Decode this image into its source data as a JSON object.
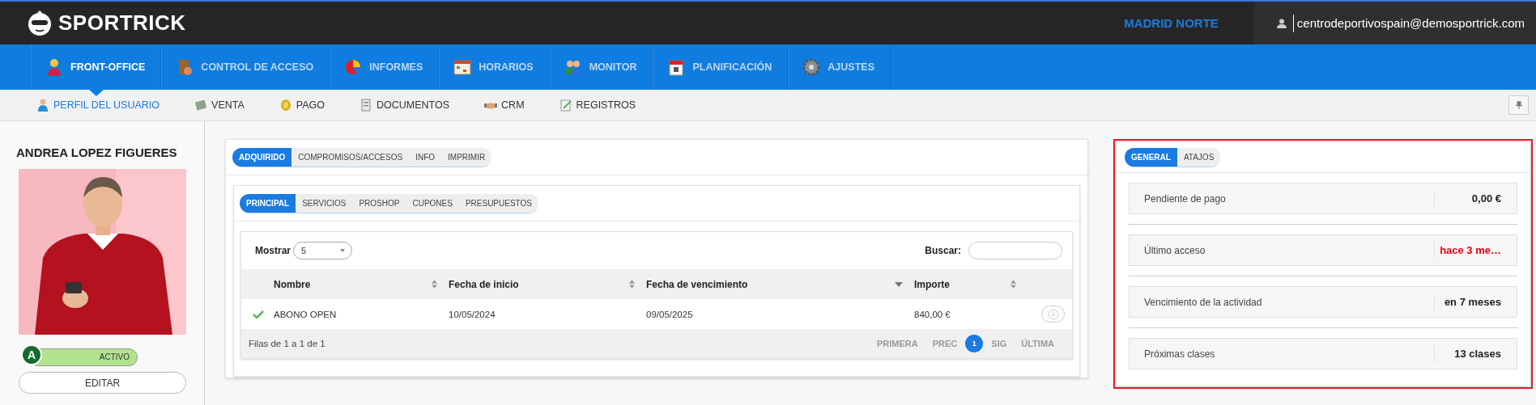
{
  "brand": {
    "name": "SPORTRICK"
  },
  "top_bar": {
    "location": "MADRID NORTE",
    "user_email": "centrodeportivospain@demosportrick.com"
  },
  "main_nav": [
    {
      "label": "FRONT-OFFICE",
      "selected": true
    },
    {
      "label": "CONTROL DE ACCESO",
      "selected": false
    },
    {
      "label": "INFORMES",
      "selected": false
    },
    {
      "label": "HORARIOS",
      "selected": false
    },
    {
      "label": "MONITOR",
      "selected": false
    },
    {
      "label": "PLANIFICACIÓN",
      "selected": false
    },
    {
      "label": "AJUSTES",
      "selected": false
    }
  ],
  "sub_nav": [
    {
      "label": "PERFIL DEL USUARIO",
      "selected": true
    },
    {
      "label": "VENTA",
      "selected": false
    },
    {
      "label": "PAGO",
      "selected": false
    },
    {
      "label": "DOCUMENTOS",
      "selected": false
    },
    {
      "label": "CRM",
      "selected": false
    },
    {
      "label": "REGISTROS",
      "selected": false
    }
  ],
  "profile": {
    "name": "ANDREA LOPEZ FIGUERES",
    "avatar_letter": "A",
    "status": "ACTIVO",
    "active": true,
    "edit_button": "EDITAR"
  },
  "section_tabs": [
    {
      "label": "ADQUIRIDO",
      "selected": true
    },
    {
      "label": "COMPROMISOS/ACCESOS",
      "selected": false
    },
    {
      "label": "INFO",
      "selected": false
    },
    {
      "label": "IMPRIMIR",
      "selected": false
    }
  ],
  "product_tabs": [
    {
      "label": "PRINCIPAL",
      "selected": true
    },
    {
      "label": "SERVICIOS",
      "selected": false
    },
    {
      "label": "PROSHOP",
      "selected": false
    },
    {
      "label": "CUPONES",
      "selected": false
    },
    {
      "label": "PRESUPUESTOS",
      "selected": false
    }
  ],
  "table": {
    "show_label": "Mostrar",
    "page_size": "5",
    "search_label": "Buscar:",
    "columns": [
      {
        "label": "Nombre",
        "sorted": false
      },
      {
        "label": "Fecha de inicio",
        "sorted": false
      },
      {
        "label": "Fecha de vencimiento",
        "sorted": true
      },
      {
        "label": "Importe",
        "sorted": false
      }
    ],
    "rows": [
      {
        "active": true,
        "cells": [
          "ABONO OPEN",
          "10/05/2024",
          "09/05/2025",
          "840,00 €"
        ]
      }
    ],
    "info": "Filas de 1 a 1 de 1",
    "pagination": [
      {
        "label": "PRIMERA",
        "selected": false,
        "disabled": true
      },
      {
        "label": "PREC",
        "selected": false,
        "disabled": true
      },
      {
        "label": "1",
        "selected": true,
        "disabled": false
      },
      {
        "label": "SIG",
        "selected": false,
        "disabled": true
      },
      {
        "label": "ÚLTIMA",
        "selected": false,
        "disabled": true
      }
    ]
  },
  "summary_tabs": [
    {
      "label": "GENERAL",
      "selected": true
    },
    {
      "label": "ATAJOS",
      "selected": false
    }
  ],
  "summary": [
    {
      "label": "Pendiente de pago",
      "value": "0,00 €",
      "alert": false
    },
    {
      "label": "Último acceso",
      "value": "hace 3 me…",
      "alert": true
    },
    {
      "label": "Vencimiento de la actividad",
      "value": "en 7 meses",
      "alert": false
    },
    {
      "label": "Próximas clases",
      "value": "13 clases",
      "alert": false
    }
  ]
}
